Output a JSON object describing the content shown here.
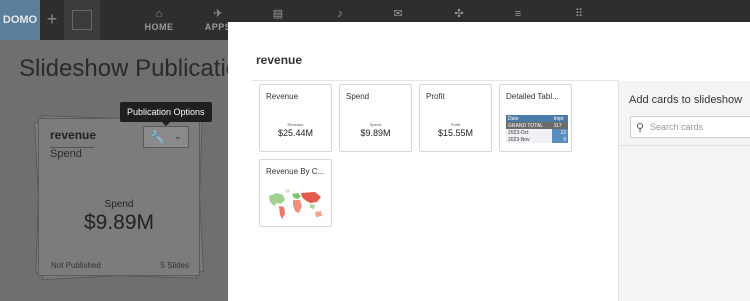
{
  "app": {
    "logo_text": "DOMO",
    "add_symbol": "+"
  },
  "nav": [
    {
      "label": "HOME",
      "icon": "home-icon",
      "glyph": "⌂"
    },
    {
      "label": "APPS",
      "icon": "rocket-icon",
      "glyph": "✈"
    }
  ],
  "nav_icons": [
    {
      "icon": "pages-icon",
      "glyph": "▤"
    },
    {
      "icon": "bell-icon",
      "glyph": "♪"
    },
    {
      "icon": "chat-icon",
      "glyph": "✉"
    },
    {
      "icon": "admin-icon",
      "glyph": "✣"
    },
    {
      "icon": "database-icon",
      "glyph": "≡"
    },
    {
      "icon": "apps-grid-icon",
      "glyph": "⠿"
    }
  ],
  "page": {
    "title": "Slideshow Publication"
  },
  "publication_card": {
    "name": "revenue",
    "subtitle": "Spend",
    "metric_label": "Spend",
    "metric_value": "$9.89M",
    "status": "Not Published",
    "slide_count": "5 Slides",
    "tools_glyph": "🔧",
    "dropdown_glyph": "⌄"
  },
  "tooltip": {
    "text": "Publication Options"
  },
  "modal": {
    "title": "revenue",
    "cards": [
      {
        "title": "Revenue",
        "small_label": "Revenue",
        "value": "$25.44M"
      },
      {
        "title": "Spend",
        "small_label": "Spend",
        "value": "$9.89M"
      },
      {
        "title": "Profit",
        "small_label": "Profit",
        "value": "$15.55M"
      },
      {
        "title": "Detailed Tabl...",
        "table": {
          "header": [
            "Date",
            "Impr"
          ],
          "total": [
            "GRAND TOTAL",
            "117"
          ],
          "rows": [
            [
              "2023-Oct",
              "12"
            ],
            [
              "2023-Nov",
              "9"
            ]
          ]
        }
      },
      {
        "title": "Revenue By C..."
      }
    ],
    "side_panel": {
      "title": "Add cards to slideshow",
      "search_placeholder": "Search cards",
      "search_value": ""
    }
  }
}
